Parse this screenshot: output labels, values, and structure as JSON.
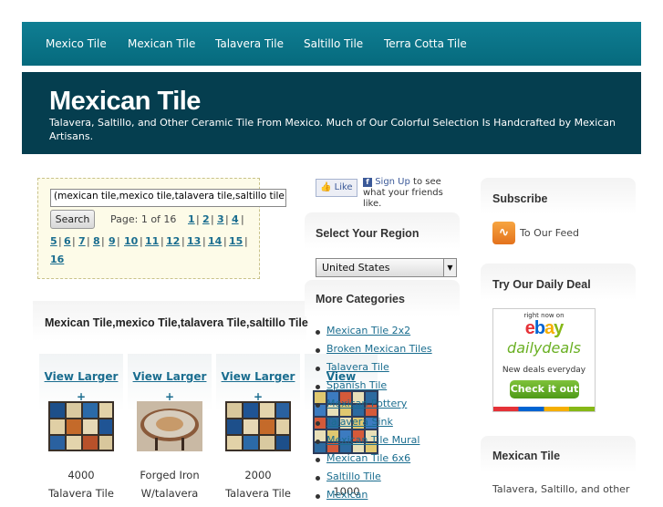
{
  "nav": {
    "items": [
      "Mexico Tile",
      "Mexican Tile",
      "Talavera Tile",
      "Saltillo Tile",
      "Terra Cotta Tile"
    ]
  },
  "header": {
    "title": "Mexican Tile",
    "tagline": "Talavera, Saltillo, and Other Ceramic Tile From Mexico. Much of Our Colorful Selection Is Handcrafted by Mexican Artisans."
  },
  "search": {
    "value": "(mexican tile,mexico tile,talavera tile,saltillo tile)",
    "button_label": "Search",
    "page_info": "Page: 1 of 16",
    "pages": [
      "1",
      "2",
      "3",
      "4",
      "5",
      "6",
      "7",
      "8",
      "9",
      "10",
      "11",
      "12",
      "13",
      "14",
      "15",
      "16"
    ]
  },
  "main": {
    "heading": "Mexican Tile,mexico Tile,talavera Tile,saltillo Tile",
    "products": [
      {
        "view_label": "View Larger",
        "plus": "+",
        "price": "4000",
        "name": "Talavera Tile"
      },
      {
        "view_label": "View Larger",
        "plus": "+",
        "price": "Forged Iron",
        "name": "W/talavera"
      },
      {
        "view_label": "View Larger",
        "plus": "+",
        "price": "2000",
        "name": "Talavera Tile"
      },
      {
        "view_label": "View Larger",
        "plus": "+",
        "price": "1000",
        "name": ""
      }
    ]
  },
  "facebook": {
    "like_label": "Like",
    "signup_link": "Sign Up",
    "signup_text": " to see what your friends like."
  },
  "region": {
    "heading": "Select Your Region",
    "selected": "United States"
  },
  "categories": {
    "heading": "More Categories",
    "items": [
      "Mexican Tile 2x2",
      "Broken Mexican Tiles",
      "Talavera Tile",
      "Spanish Tile",
      "Mexican Pottery",
      "Talavera Sink",
      "Mexican Tile Mural",
      "Mexican Tile 6x6",
      "Saltillo Tile",
      "Mexican"
    ]
  },
  "subscribe": {
    "heading": "Subscribe",
    "feed_label": "To Our Feed"
  },
  "deal": {
    "heading": "Try Our Daily Deal",
    "right_now": "right now on",
    "ebay": "ebay",
    "dailydeals": "dailydeals",
    "tagline": "New deals everyday",
    "button": "Check it out"
  },
  "sidebar_tile": {
    "heading": "Mexican Tile",
    "text": "Talavera, Saltillo, and other"
  },
  "colors": {
    "nav_bg": "#0a7488",
    "header_bg": "#053e4f",
    "link": "#1a6d8f"
  }
}
